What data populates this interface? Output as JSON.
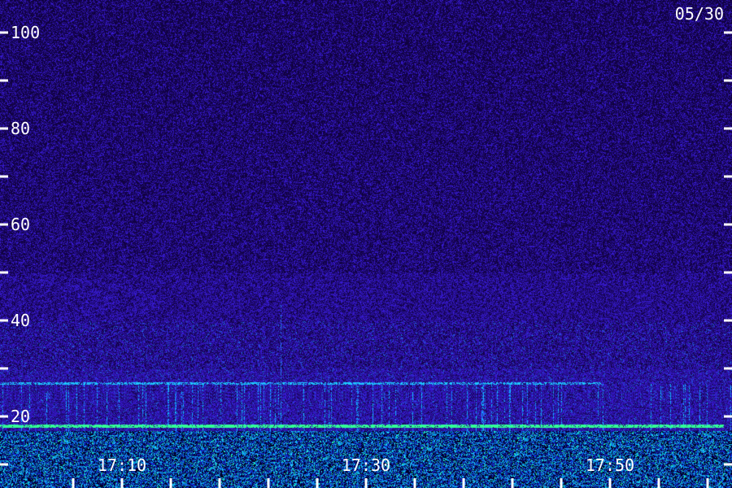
{
  "chart_data": {
    "type": "heatmap",
    "date_label": "05/30",
    "y_axis": {
      "ylim": [
        0,
        110
      ],
      "major_ticks": [
        20,
        40,
        60,
        80,
        100
      ],
      "minor_ticks": [
        10,
        30,
        50,
        70,
        90
      ],
      "tick_labels": [
        "20",
        "40",
        "60",
        "80",
        "100"
      ]
    },
    "x_axis": {
      "xlim": [
        "17:06",
        "17:59"
      ],
      "tick_labels": [
        "17:10",
        "17:30",
        "17:50"
      ],
      "major_ticks": [
        "17:10",
        "17:30",
        "17:50"
      ],
      "minor_ticks": [
        "17:06",
        "17:14",
        "17:18",
        "17:22",
        "17:26",
        "17:34",
        "17:38",
        "17:42",
        "17:46",
        "17:54",
        "17:58"
      ]
    },
    "features": [
      {
        "kind": "horizontal_band",
        "y": 18,
        "intensity": "high"
      },
      {
        "kind": "horizontal_band",
        "y": 27,
        "intensity": "medium"
      },
      {
        "kind": "low_frequency_noise",
        "y_range": [
          0,
          17
        ],
        "intensity": "high"
      },
      {
        "kind": "vertical_streak",
        "x": "17:22",
        "y_range": [
          22,
          44
        ],
        "intensity": "low"
      }
    ],
    "colors": {
      "background": "#1a0a52",
      "noise_low": "#2a14a0",
      "noise_high": "#3c3cff",
      "band": "#40ffb0",
      "band_cyan": "#28d0ff",
      "axis": "#ffffff"
    }
  }
}
